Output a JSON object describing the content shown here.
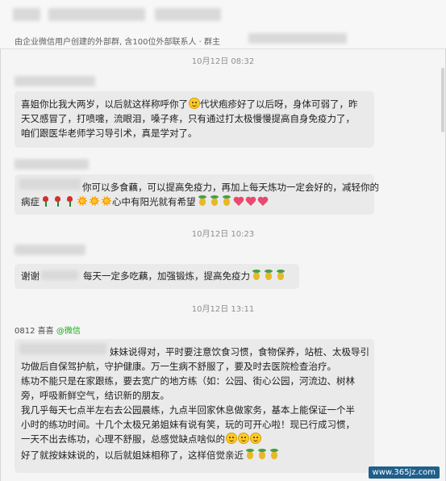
{
  "header": {
    "subtitle": "由企业微信用户创建的外部群, 含100位外部联系人 · 群主"
  },
  "timestamps": [
    "10月12日 08:32",
    "10月12日 10:23",
    "10月12日 13:11"
  ],
  "messages": [
    {
      "lines": [
        "喜姐你比我大两岁，以后就这样称呼你了",
        "代状疱疹好了以后呀，身体可弱了，昨",
        "天又感冒了，打喷嚏，流眼泪，嗓子疼，只有通过打太极慢慢提高自身免疫力了，",
        "咱们跟医华老师学习导引术，真是学对了。"
      ]
    },
    {
      "lines": [
        "你可以多食藕，可以提高免疫力，再加上每天炼功一定会好的，减轻你的",
        "病症",
        "心中有阳光就有希望"
      ]
    },
    {
      "lines": [
        "谢谢",
        "每天一定多吃藕，加强锻炼，提高免疫力"
      ]
    },
    {
      "sender_name": "0812 喜喜",
      "sender_source": "@微信",
      "lines": [
        "妹妹说得对，平时要注意饮食习惯，食物保养，站桩、太极导引",
        "功做后自保驾护航，守护健康。万一生病不舒服了，要及时去医院检查治疗。",
        "练功不能只是在家跟练，要去宽广的地方练（如：公园、街心公园，河流边、树林",
        "旁，呼吸新鲜空气，结识新的朋友。",
        "我几乎每天七点半左右去公园晨练，九点半回家休息做家务，基本上能保证一个半",
        "小时的练功时间。十几个太极兄弟姐妹有说有笑，玩的可开心啦！现已行成习惯，",
        "一天不出去练功，心理不舒服，总感觉缺点啥似的",
        "好了就按妹妹说的，以后就姐妹相称了，这样倍觉亲近"
      ]
    }
  ],
  "watermark": "www.365jz.com"
}
